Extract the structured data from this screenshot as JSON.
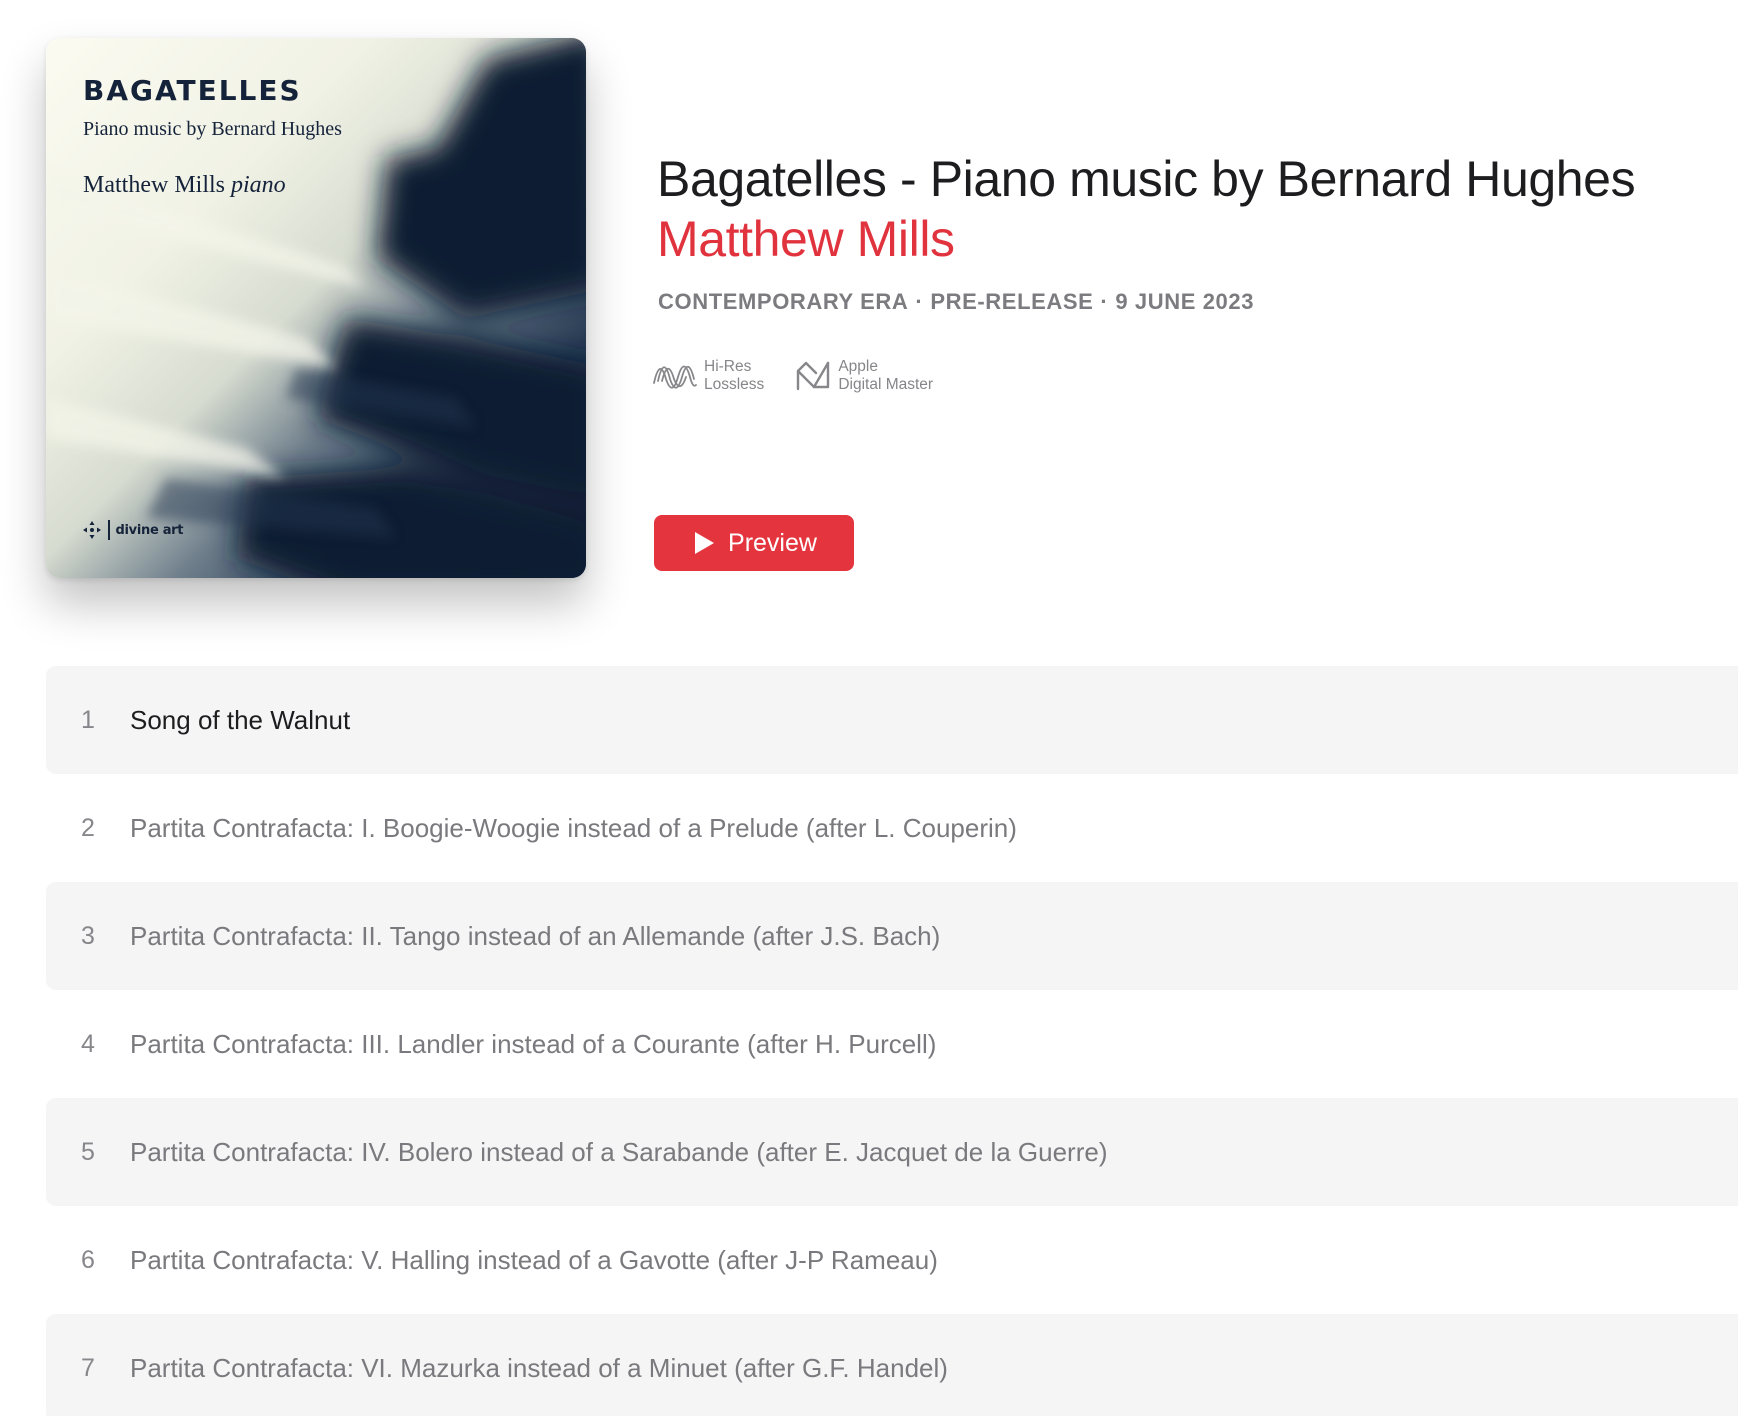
{
  "artwork": {
    "title": "BAGATELLES",
    "subtitle": "Piano music by Bernard Hughes",
    "artist": "Matthew Mills",
    "instrument": "piano",
    "label": "divine art"
  },
  "album": {
    "title": "Bagatelles - Piano music by Bernard Hughes",
    "artist": "Matthew Mills",
    "era": "CONTEMPORARY ERA",
    "status": "PRE-RELEASE",
    "release_date": "9 JUNE 2023",
    "separator": "·"
  },
  "badges": {
    "hires": {
      "line1": "Hi-Res",
      "line2": "Lossless",
      "icon": "hi-res-lossless-icon"
    },
    "adm": {
      "line1": "Apple",
      "line2": "Digital Master",
      "icon": "apple-digital-master-icon"
    }
  },
  "preview_button": {
    "label": "Preview",
    "icon": "play-icon"
  },
  "colors": {
    "accent": "#e0333d",
    "text_primary": "#1d1d1f",
    "text_secondary": "#7c7c80",
    "row_stripe": "#f5f5f6"
  },
  "tracks": [
    {
      "number": "1",
      "title": "Song of the Walnut"
    },
    {
      "number": "2",
      "title": "Partita Contrafacta: I. Boogie-Woogie instead of a Prelude (after L. Couperin)"
    },
    {
      "number": "3",
      "title": "Partita Contrafacta: II. Tango instead of an Allemande (after J.S. Bach)"
    },
    {
      "number": "4",
      "title": "Partita Contrafacta: III. Landler instead of a Courante (after H. Purcell)"
    },
    {
      "number": "5",
      "title": "Partita Contrafacta: IV. Bolero instead of a Sarabande (after E. Jacquet de la Guerre)"
    },
    {
      "number": "6",
      "title": "Partita Contrafacta: V. Halling instead of a Gavotte (after J-P Rameau)"
    },
    {
      "number": "7",
      "title": "Partita Contrafacta: VI. Mazurka instead of a Minuet (after G.F. Handel)"
    }
  ]
}
